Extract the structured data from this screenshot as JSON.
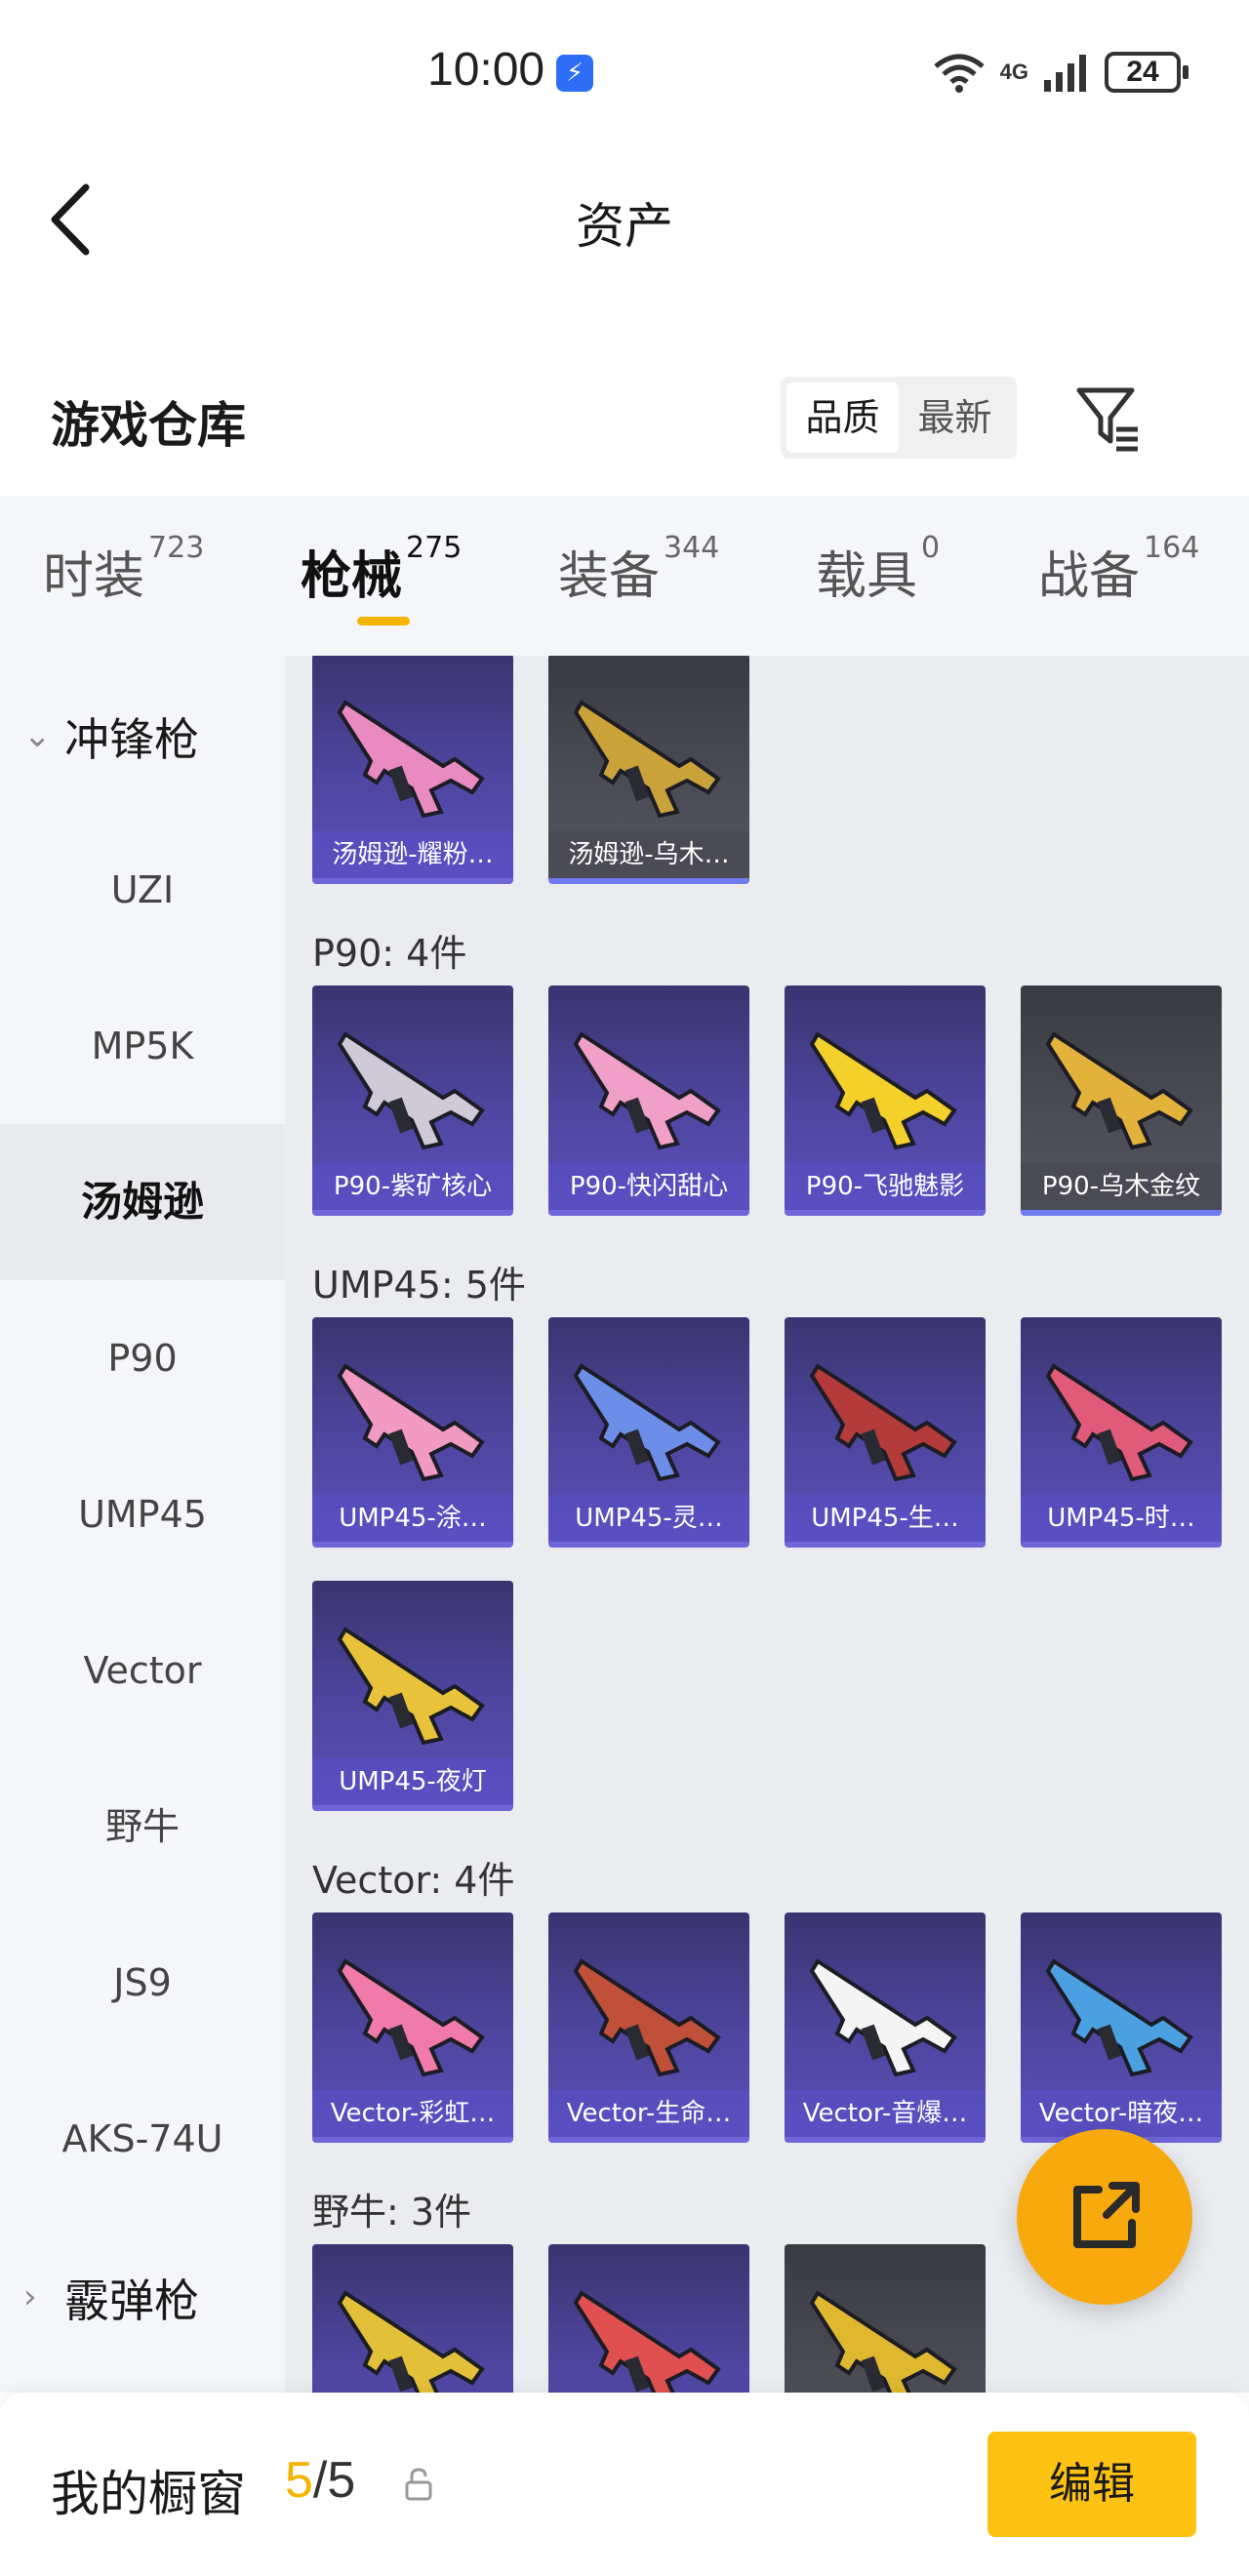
{
  "status_bar": {
    "time": "10:00",
    "network": "4G",
    "battery": "24"
  },
  "header": {
    "title": "资产"
  },
  "section": {
    "title": "游戏仓库",
    "sort_options": [
      "品质",
      "最新"
    ],
    "active_sort": "品质"
  },
  "category_tabs": [
    {
      "label": "时装",
      "count": "723"
    },
    {
      "label": "枪械",
      "count": "275"
    },
    {
      "label": "装备",
      "count": "344"
    },
    {
      "label": "载具",
      "count": "0"
    },
    {
      "label": "战备",
      "count": "164"
    }
  ],
  "active_tab": "枪械",
  "sidebar": {
    "group_smg": "冲锋枪",
    "items": [
      "UZI",
      "MP5K",
      "汤姆逊",
      "P90",
      "UMP45",
      "Vector",
      "野牛",
      "JS9",
      "AKS-74U"
    ],
    "active_item": "汤姆逊",
    "group_shotgun": "霰弹枪"
  },
  "groups": [
    {
      "label": "",
      "items": [
        {
          "name": "汤姆逊-耀粉…",
          "tint": "#e98bc0"
        },
        {
          "name": "汤姆逊-乌木…",
          "tint": "#c9a23a"
        }
      ]
    },
    {
      "label": "P90: 4件",
      "items": [
        {
          "name": "P90-紫矿核心",
          "tint": "#cfc9d8"
        },
        {
          "name": "P90-快闪甜心",
          "tint": "#f0a0c8"
        },
        {
          "name": "P90-飞驰魅影",
          "tint": "#f4d02a"
        },
        {
          "name": "P90-乌木金纹",
          "tint": "#e3b23a"
        }
      ]
    },
    {
      "label": "UMP45: 5件",
      "items": [
        {
          "name": "UMP45-涂…",
          "tint": "#f29ac2"
        },
        {
          "name": "UMP45-灵…",
          "tint": "#6c8ee8"
        },
        {
          "name": "UMP45-生…",
          "tint": "#b53a3a"
        },
        {
          "name": "UMP45-时…",
          "tint": "#e05a7a"
        },
        {
          "name": "UMP45-夜灯",
          "tint": "#e8c23a"
        }
      ]
    },
    {
      "label": "Vector: 4件",
      "items": [
        {
          "name": "Vector-彩虹…",
          "tint": "#f07aa8"
        },
        {
          "name": "Vector-生命…",
          "tint": "#c0503a"
        },
        {
          "name": "Vector-音爆…",
          "tint": "#f4f4f4"
        },
        {
          "name": "Vector-暗夜…",
          "tint": "#4aa0e0"
        }
      ]
    },
    {
      "label": "野牛: 3件",
      "items": [
        {
          "name": "",
          "tint": "#e3c03a"
        },
        {
          "name": "",
          "tint": "#e05050"
        },
        {
          "name": "",
          "tint": "#e0b830"
        }
      ]
    }
  ],
  "bottom": {
    "showcase_label": "我的橱窗",
    "current": "5",
    "separator": "/",
    "total": "5",
    "edit_label": "编辑"
  }
}
